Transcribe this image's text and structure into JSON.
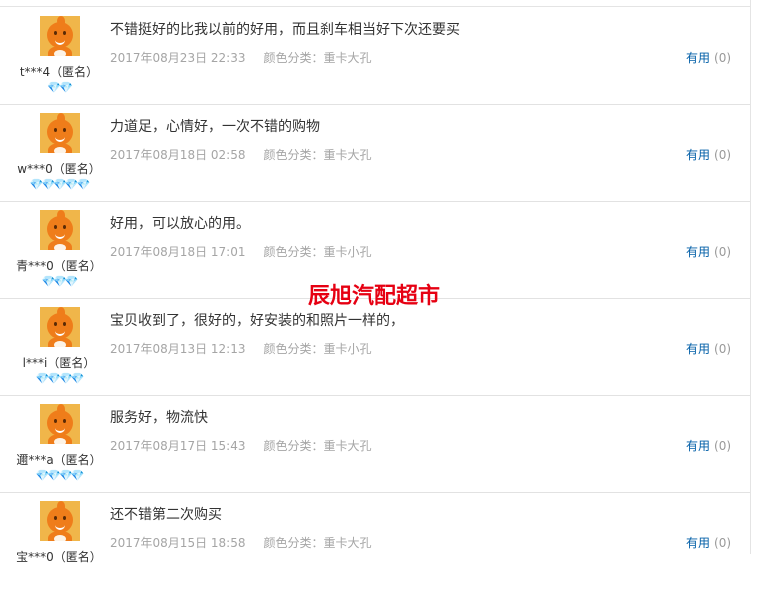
{
  "useful_label": "有用",
  "watermark": "辰旭汽配超市",
  "reviews": [
    {
      "user": "t***4（匿名）",
      "level": "💎💎",
      "content": "不错挺好的比我以前的好用，而且刹车相当好下次还要买",
      "date": "2017年08月23日 22:33",
      "color_label": "颜色分类：",
      "color_value": "重卡大孔",
      "useful_count": "(0)"
    },
    {
      "user": "w***0（匿名）",
      "level": "💎💎💎💎💎",
      "content": "力道足，心情好，一次不错的购物",
      "date": "2017年08月18日 02:58",
      "color_label": "颜色分类：",
      "color_value": "重卡大孔",
      "useful_count": "(0)"
    },
    {
      "user": "青***0（匿名）",
      "level": "💎💎💎",
      "content": "好用，可以放心的用。",
      "date": "2017年08月18日 17:01",
      "color_label": "颜色分类：",
      "color_value": "重卡小孔",
      "useful_count": "(0)"
    },
    {
      "user": "l***i（匿名）",
      "level": "💎💎💎💎",
      "content": "宝贝收到了，很好的，好安装的和照片一样的，",
      "date": "2017年08月13日 12:13",
      "color_label": "颜色分类：",
      "color_value": "重卡小孔",
      "useful_count": "(0)"
    },
    {
      "user": "邇***a（匿名）",
      "level": "💎💎💎💎",
      "content": "服务好，物流快",
      "date": "2017年08月17日 15:43",
      "color_label": "颜色分类：",
      "color_value": "重卡大孔",
      "useful_count": "(0)"
    },
    {
      "user": "宝***0（匿名）",
      "level": "",
      "content": "还不错第二次购买",
      "date": "2017年08月15日 18:58",
      "color_label": "颜色分类：",
      "color_value": "重卡大孔",
      "useful_count": "(0)"
    }
  ]
}
